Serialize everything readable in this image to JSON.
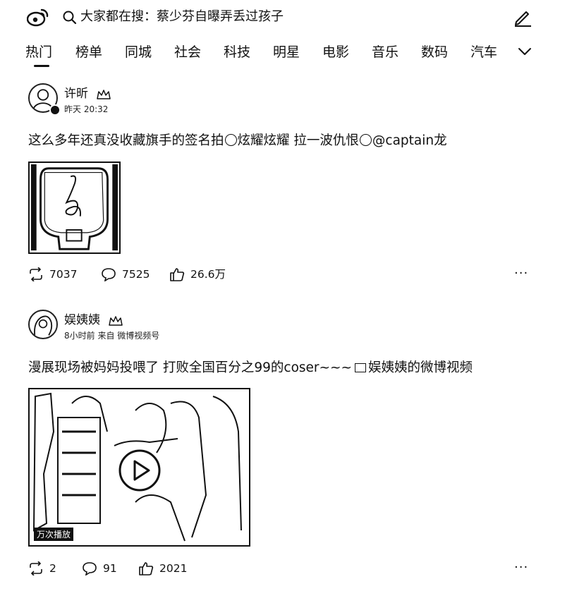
{
  "header": {
    "logo_icon": "weibo-logo",
    "search_icon": "search-icon",
    "search_text": "大家都在搜：蔡少芬自曝弄丢过孩子",
    "edit_icon": "edit-icon"
  },
  "tabs": [
    {
      "label": "热门",
      "active": true
    },
    {
      "label": "榜单"
    },
    {
      "label": "同城"
    },
    {
      "label": "社会"
    },
    {
      "label": "科技"
    },
    {
      "label": "明星"
    },
    {
      "label": "电影"
    },
    {
      "label": "音乐"
    },
    {
      "label": "数码"
    },
    {
      "label": "汽车"
    }
  ],
  "more_tabs_icon": "chevron-down-icon",
  "posts": [
    {
      "author": "许昕",
      "meta": "昨天 20:32",
      "content_parts": [
        "这么多年还真没收藏旗手的签名拍",
        "炫耀炫耀 拉一波仇恨",
        "@captain龙"
      ],
      "image": "table-tennis-paddle-signature",
      "reposts": "7037",
      "comments": "7525",
      "likes": "26.6万"
    },
    {
      "author": "娱姨姨",
      "meta": "8小时前 来自 微博视频号",
      "content_parts": [
        "漫展现场被妈妈投喂了 打败全国百分之99的coser~~~",
        "娱姨姨的微博视频"
      ],
      "image": "video-thumbnail",
      "views": "万次播放",
      "reposts": "2",
      "comments": "91",
      "likes": "2021"
    }
  ],
  "more_icon": "more-dots-icon",
  "colors": {
    "text": "#111111",
    "background": "#ffffff"
  }
}
